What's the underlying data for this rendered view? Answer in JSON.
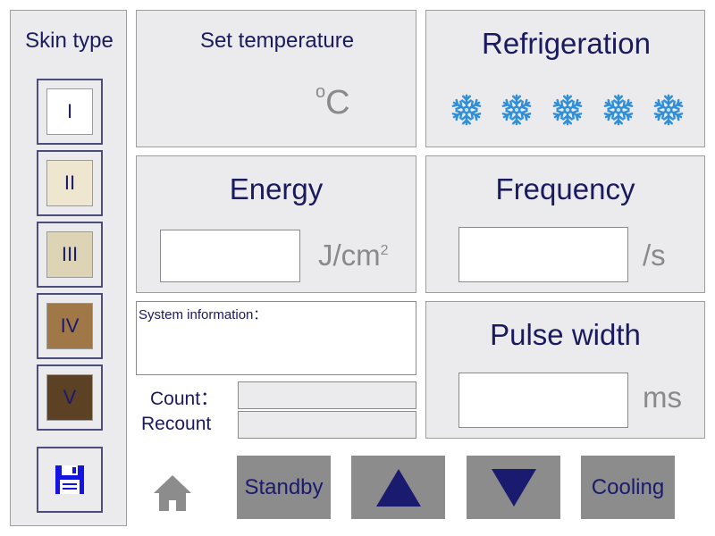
{
  "sidebar": {
    "title": "Skin type",
    "skin_types": [
      {
        "label": "I",
        "color": "#ffffff"
      },
      {
        "label": "II",
        "color": "#efe6cf"
      },
      {
        "label": "III",
        "color": "#ddd3b5"
      },
      {
        "label": "IV",
        "color": "#a07848"
      },
      {
        "label": "V",
        "color": "#5c4124"
      }
    ],
    "save_icon": "floppy-disk-icon"
  },
  "temperature": {
    "label": "Set temperature",
    "unit_degree": "o",
    "unit_letter": "C"
  },
  "refrigeration": {
    "label": "Refrigeration",
    "icon": "snowflake-icon",
    "level_count": 5
  },
  "energy": {
    "label": "Energy",
    "value": "",
    "unit": "J/cm",
    "unit_sup": "2"
  },
  "frequency": {
    "label": "Frequency",
    "value": "",
    "unit": "/s"
  },
  "pulse_width": {
    "label": "Pulse width",
    "value": "",
    "unit": "ms"
  },
  "system_info": {
    "label": "System information：",
    "text": ""
  },
  "counts": {
    "count_label": "Count：",
    "recount_label": "Recount",
    "count_value": "",
    "recount_value": ""
  },
  "bottom": {
    "home_icon": "home-icon",
    "standby_label": "Standby",
    "up_icon": "triangle-up-icon",
    "down_icon": "triangle-down-icon",
    "cooling_label": "Cooling"
  },
  "colors": {
    "text": "#1a1a5e",
    "panel_bg": "#ebebed",
    "button_bg": "#8c8c8c",
    "accent": "#1a1a8e",
    "snowflake": "#2f8fd8"
  }
}
